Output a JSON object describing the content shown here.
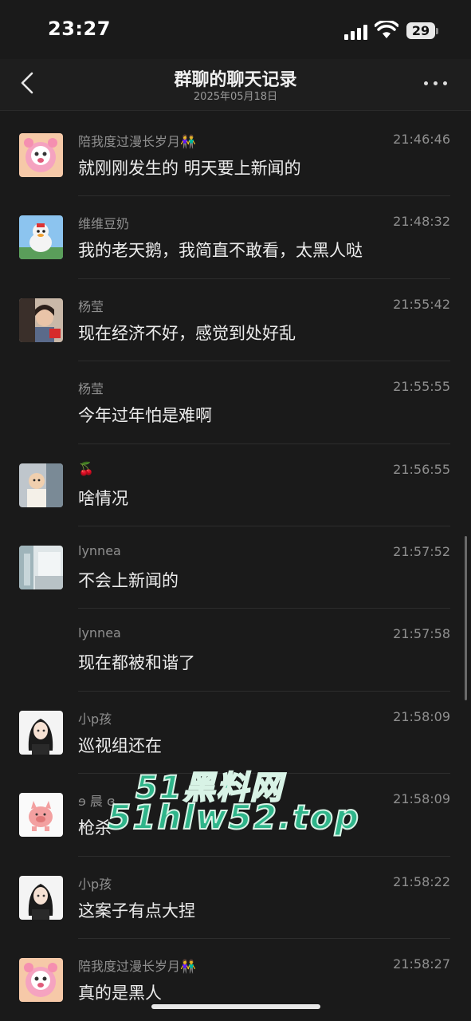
{
  "status_bar": {
    "time": "23:27",
    "battery": "29"
  },
  "header": {
    "title": "群聊的聊天记录",
    "date": "2025年05月18日"
  },
  "messages": [
    {
      "name": "陪我度过漫长岁月👫",
      "time": "21:46:46",
      "text": "就刚刚发生的 明天要上新闻的",
      "avatar": "pink-cartoon-avatar"
    },
    {
      "name": "维维豆奶",
      "time": "21:48:32",
      "text": "我的老天鹅，我简直不敢看，太黑人哒",
      "avatar": "toy-figure-avatar"
    },
    {
      "name": "杨莹",
      "time": "21:55:42",
      "text": "现在经济不好，感觉到处好乱",
      "avatar": "photo-avatar"
    },
    {
      "name": "杨莹",
      "time": "21:55:55",
      "text": "今年过年怕是难啊",
      "avatar": ""
    },
    {
      "name": "🍒",
      "time": "21:56:55",
      "text": "啥情况",
      "avatar": "child-photo-avatar"
    },
    {
      "name": "lynnea",
      "time": "21:57:52",
      "text": "不会上新闻的",
      "avatar": "room-photo-avatar"
    },
    {
      "name": "lynnea",
      "time": "21:57:58",
      "text": "现在都被和谐了",
      "avatar": ""
    },
    {
      "name": "小p孩",
      "time": "21:58:09",
      "text": "巡视组还在",
      "avatar": "anime-girl-avatar"
    },
    {
      "name": "ɘ 晨 ɞ",
      "time": "21:58:09",
      "text": "枪杀",
      "avatar": "pig-avatar"
    },
    {
      "name": "小p孩",
      "time": "21:58:22",
      "text": "这案子有点大捏",
      "avatar": "anime-girl-avatar"
    },
    {
      "name": "陪我度过漫长岁月👫",
      "time": "21:58:27",
      "text": "真的是黑人",
      "avatar": "pink-cartoon-avatar"
    }
  ],
  "watermark": {
    "line1": "51黑料网",
    "line2": "51hlw52.top"
  },
  "colors": {
    "background": "#1a1a1a",
    "watermark": "#2fb58a"
  }
}
